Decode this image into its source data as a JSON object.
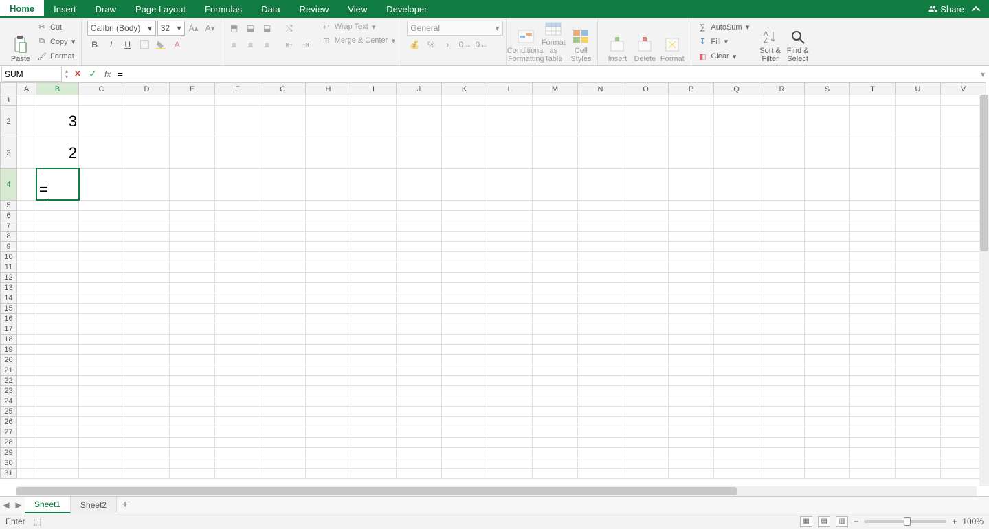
{
  "menubar": {
    "tabs": [
      "Home",
      "Insert",
      "Draw",
      "Page Layout",
      "Formulas",
      "Data",
      "Review",
      "View",
      "Developer"
    ],
    "active_index": 0,
    "share_label": "Share"
  },
  "ribbon": {
    "clipboard": {
      "paste": "Paste",
      "cut": "Cut",
      "copy": "Copy",
      "format": "Format"
    },
    "font": {
      "name": "Calibri (Body)",
      "size": "32",
      "bold": "B",
      "italic": "I",
      "underline": "U"
    },
    "alignment": {
      "wrap": "Wrap Text",
      "merge": "Merge & Center"
    },
    "number": {
      "format": "General"
    },
    "styles": {
      "cond": "Conditional Formatting",
      "table": "Format as Table",
      "cell": "Cell Styles"
    },
    "cells": {
      "insert": "Insert",
      "delete": "Delete",
      "format": "Format"
    },
    "editing": {
      "autosum": "AutoSum",
      "fill": "Fill",
      "clear": "Clear",
      "sort": "Sort & Filter",
      "find": "Find & Select"
    }
  },
  "formula_bar": {
    "name_box": "SUM",
    "fx_label": "fx",
    "formula": "="
  },
  "grid": {
    "columns": [
      "A",
      "B",
      "C",
      "D",
      "E",
      "F",
      "G",
      "H",
      "I",
      "J",
      "K",
      "L",
      "M",
      "N",
      "O",
      "P",
      "Q",
      "R",
      "S",
      "T",
      "U",
      "V"
    ],
    "row_count": 31,
    "active_col_index": 1,
    "active_row_index": 3,
    "col_widths": {
      "default": 66,
      "A": 28,
      "B": 62
    },
    "row_heights": {
      "default": 15,
      "2": 46,
      "3": 46,
      "4": 46
    },
    "cells": {
      "B2": "3",
      "B3": "2"
    },
    "editing_cell": {
      "ref": "B4",
      "value": "="
    }
  },
  "sheets": {
    "tabs": [
      "Sheet1",
      "Sheet2"
    ],
    "active_index": 0,
    "add_symbol": "+"
  },
  "status": {
    "mode": "Enter",
    "zoom": "100%"
  }
}
